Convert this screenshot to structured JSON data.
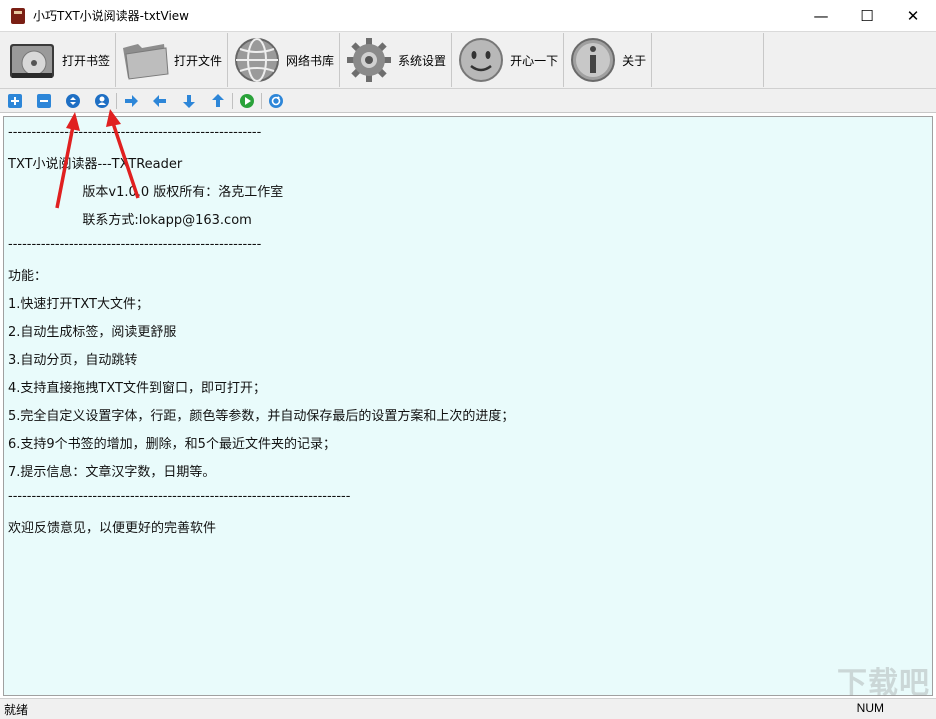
{
  "window": {
    "title": "小巧TXT小说阅读器-txtView",
    "minimize": "—",
    "maximize": "☐",
    "close": "✕"
  },
  "toolbar": {
    "items": [
      {
        "label": "打开书签",
        "icon": "bookmark-disc-icon"
      },
      {
        "label": "打开文件",
        "icon": "folder-icon"
      },
      {
        "label": "网络书库",
        "icon": "globe-icon"
      },
      {
        "label": "系统设置",
        "icon": "gear-icon"
      },
      {
        "label": "开心一下",
        "icon": "smiley-icon"
      },
      {
        "label": "关于",
        "icon": "info-icon"
      }
    ]
  },
  "iconbar": {
    "icons": [
      "zoom-in-icon",
      "zoom-out-icon",
      "expand-icon",
      "person-icon",
      "next-icon",
      "back-icon",
      "down-icon",
      "up-icon",
      "play-icon",
      "refresh-icon"
    ]
  },
  "content": {
    "lines": [
      "------------------------------------------------------",
      "TXT小说阅读器---TXTReader",
      "                  版本v1.0.0 版权所有：洛克工作室",
      "                  联系方式:lokapp@163.com",
      "------------------------------------------------------",
      "功能：",
      "1.快速打开TXT大文件；",
      "2.自动生成标签，阅读更舒服",
      "3.自动分页，自动跳转",
      "4.支持直接拖拽TXT文件到窗口，即可打开；",
      "5.完全自定义设置字体，行距，颜色等参数，并自动保存最后的设置方案和上次的进度；",
      "6.支持9个书签的增加，删除，和5个最近文件夹的记录；",
      "7.提示信息：文章汉字数，日期等。",
      "-------------------------------------------------------------------------",
      "欢迎反馈意见，以便更好的完善软件"
    ]
  },
  "status": {
    "text": "就绪",
    "num": "NUM"
  },
  "watermark": "下载吧",
  "colors": {
    "content_bg": "#e9fbfb",
    "arrow": "#e02020",
    "icon_blue": "#1e73c8"
  }
}
